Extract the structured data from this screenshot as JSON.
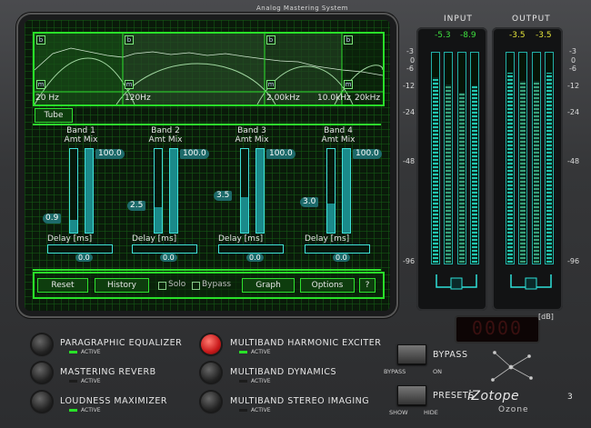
{
  "header": {
    "title": "Analog Mastering System"
  },
  "eq": {
    "freq_labels": [
      "20 Hz",
      "120Hz",
      "2.00kHz",
      "10.0kHz",
      "20kHz"
    ],
    "band_markers": [
      "b",
      "b",
      "b",
      "b"
    ],
    "mute_markers": [
      "m",
      "m",
      "m",
      "m"
    ]
  },
  "tube_label": "Tube",
  "bands": [
    {
      "title": "Band 1",
      "amt_mix": "Amt  Mix",
      "amount": "0.9",
      "mix": "100.0",
      "delay_label": "Delay [ms]",
      "delay": "0.0"
    },
    {
      "title": "Band 2",
      "amt_mix": "Amt  Mix",
      "amount": "2.5",
      "mix": "100.0",
      "delay_label": "Delay [ms]",
      "delay": "0.0"
    },
    {
      "title": "Band 3",
      "amt_mix": "Amt  Mix",
      "amount": "3.5",
      "mix": "100.0",
      "delay_label": "Delay [ms]",
      "delay": "0.0"
    },
    {
      "title": "Band 4",
      "amt_mix": "Amt  Mix",
      "amount": "3.0",
      "mix": "100.0",
      "delay_label": "Delay [ms]",
      "delay": "0.0"
    }
  ],
  "screen_buttons": {
    "reset": "Reset",
    "history": "History",
    "solo": "Solo",
    "bypass": "Bypass",
    "graph": "Graph",
    "options": "Options",
    "help": "?"
  },
  "meters": {
    "input_title": "INPUT",
    "output_title": "OUTPUT",
    "input_peak_l": "-5.3",
    "input_peak_r": "-8.9",
    "output_peak_l": "-3.5",
    "output_peak_r": "-3.5",
    "scale": [
      "-3",
      "0",
      "-6",
      "-12",
      "-24",
      "-48",
      "-96"
    ],
    "db_label": "[dB]",
    "input_level": [
      0.88,
      0.84
    ],
    "output_level": [
      0.9,
      0.9
    ]
  },
  "led_display": "0000",
  "modules": [
    {
      "label": "PARAGRAPHIC EQUALIZER",
      "state": "ACTIVE"
    },
    {
      "label": "MASTERING REVERB",
      "state": "ACTIVE"
    },
    {
      "label": "LOUDNESS MAXIMIZER",
      "state": "ACTIVE"
    },
    {
      "label": "MULTIBAND HARMONIC EXCITER",
      "state": "ACTIVE"
    },
    {
      "label": "MULTIBAND DYNAMICS",
      "state": "ACTIVE"
    },
    {
      "label": "MULTIBAND STEREO IMAGING",
      "state": "ACTIVE"
    }
  ],
  "bypass": {
    "label": "BYPASS",
    "off": "BYPASS",
    "on": "ON"
  },
  "presets": {
    "label": "PRESETS",
    "show": "SHOW",
    "hide": "HIDE"
  },
  "brand": {
    "name": "iZotope",
    "product": "Ozone",
    "version": "3"
  }
}
